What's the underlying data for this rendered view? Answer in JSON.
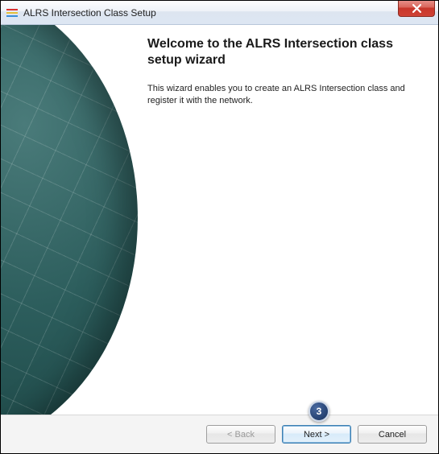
{
  "window": {
    "title": "ALRS Intersection Class Setup"
  },
  "content": {
    "heading": "Welcome to the ALRS Intersection class setup wizard",
    "description": "This wizard enables you to create an ALRS Intersection class and register it with the network."
  },
  "footer": {
    "back_label": "< Back",
    "next_label": "Next >",
    "cancel_label": "Cancel"
  },
  "callout": {
    "number": "3"
  }
}
